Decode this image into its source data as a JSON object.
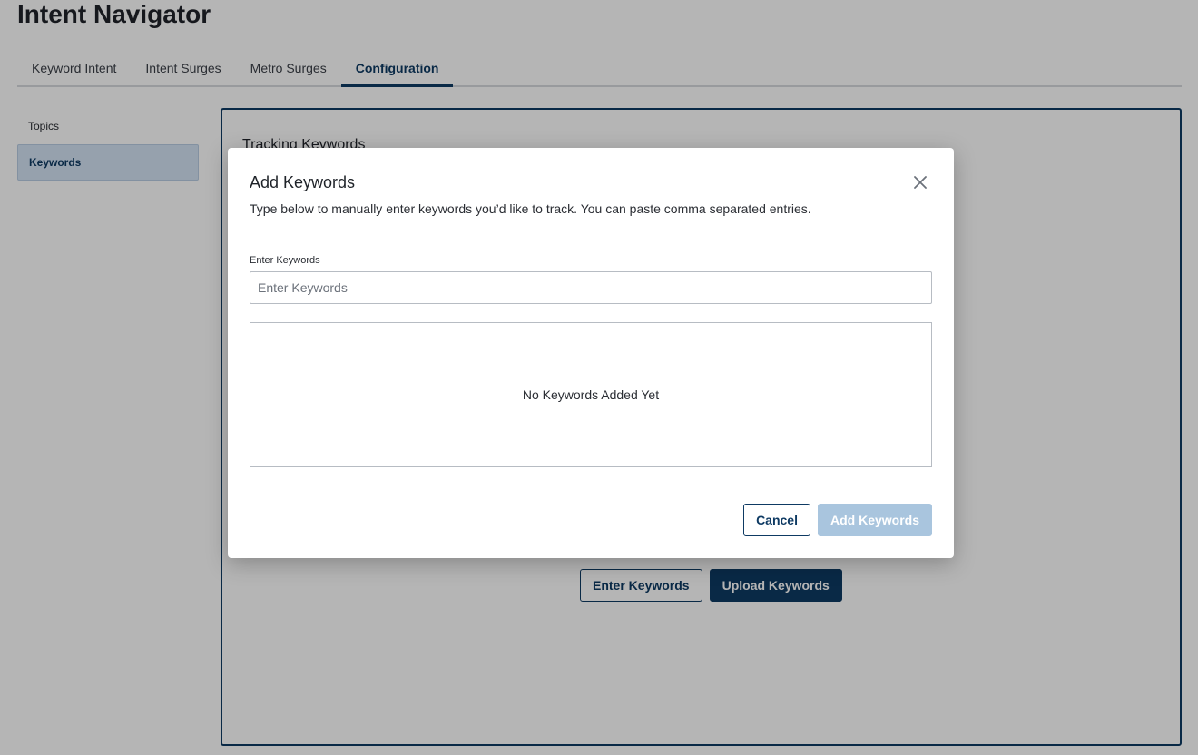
{
  "app": {
    "title": "Intent Navigator"
  },
  "tabs": [
    {
      "label": "Keyword Intent",
      "active": false
    },
    {
      "label": "Intent Surges",
      "active": false
    },
    {
      "label": "Metro Surges",
      "active": false
    },
    {
      "label": "Configuration",
      "active": true
    }
  ],
  "side_nav": {
    "items": [
      {
        "label": "Topics",
        "active": false
      },
      {
        "label": "Keywords",
        "active": true
      }
    ]
  },
  "panel": {
    "heading": "Tracking Keywords",
    "enter_button": "Enter Keywords",
    "upload_button": "Upload Keywords"
  },
  "modal": {
    "title": "Add Keywords",
    "description": "Type below to manually enter keywords you’d like to track. You can paste comma separated entries.",
    "field_label": "Enter Keywords",
    "input_value": "",
    "input_placeholder": "Enter Keywords",
    "empty_state": "No Keywords Added Yet",
    "cancel_label": "Cancel",
    "submit_label": "Add Keywords",
    "close_icon": "close-icon"
  },
  "colors": {
    "brand_navy": "#0e3a63",
    "active_nav_bg": "#d3e3f4",
    "disabled_button": "#a9c5de",
    "overlay": "rgba(0,0,0,0.29)"
  }
}
